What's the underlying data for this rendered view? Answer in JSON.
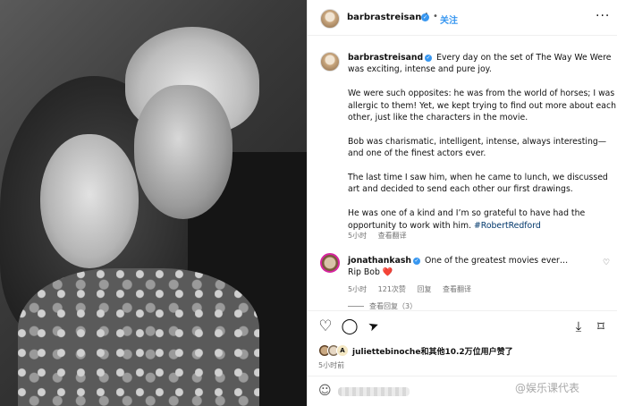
{
  "header": {
    "username": "barbrastreisand",
    "follow_label": "关注",
    "more_label": "···"
  },
  "caption": {
    "username": "barbrastreisand",
    "paragraphs": [
      "Every day on the set of The Way We Were was exciting, intense and pure joy.",
      "We were such opposites: he was from the world of horses; I was allergic to them! Yet, we kept trying to find out more about each other, just like the characters in the movie.",
      "Bob was charismatic, intelligent, intense, always interesting—and one of the finest actors ever.",
      "The last time I saw him, when he came to lunch, we discussed art and decided to send each other our first drawings.",
      "He was one of a kind and I’m so grateful to have had the opportunity to work with him."
    ],
    "hashtag": "#RobertRedford",
    "time": "5小时",
    "see_translation": "查看翻译"
  },
  "comment": {
    "username": "jonathankash",
    "text": "One of the greatest movies ever…",
    "text_line2": "Rip Bob",
    "heart_emoji": "❤️",
    "time": "5小时",
    "likes": "121次赞",
    "reply": "回复",
    "see_translation": "查看翻译",
    "view_replies": "查看回复（3）"
  },
  "actions": {
    "like_icon": "heart-outline-icon",
    "comment_icon": "comment-bubble-icon",
    "share_icon": "send-paper-plane-icon",
    "download_icon": "download-icon",
    "save_icon": "bookmark-icon"
  },
  "likes": {
    "text": "juliettebinoche和其他10.2万位用户赞了"
  },
  "time_ago": "5小时前",
  "watermark": "@娱乐课代表",
  "colors": {
    "verified": "#3897f0",
    "link": "#00376b",
    "follow": "#3897f0",
    "muted": "#737373"
  }
}
